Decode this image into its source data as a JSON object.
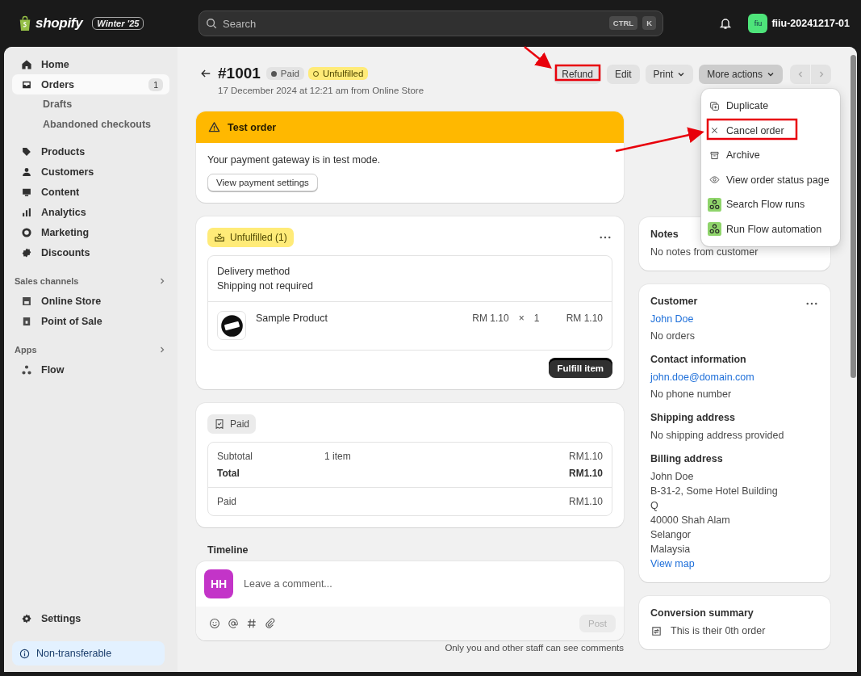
{
  "topbar": {
    "logo": "shopify",
    "edition_badge": "Winter '25",
    "search": {
      "placeholder": "Search",
      "shortcut": [
        "CTRL",
        "K"
      ]
    },
    "avatar": "fiu",
    "store_name": "fiiu-20241217-01"
  },
  "sidebar": {
    "items": [
      {
        "label": "Home",
        "selected": false
      },
      {
        "label": "Orders",
        "selected": true,
        "badge": "1",
        "children": [
          {
            "label": "Drafts",
            "selected": false
          },
          {
            "label": "Abandoned checkouts",
            "selected": false
          }
        ]
      },
      {
        "label": "Products",
        "selected": false
      },
      {
        "label": "Customers",
        "selected": false
      },
      {
        "label": "Content",
        "selected": false
      },
      {
        "label": "Analytics",
        "selected": false
      },
      {
        "label": "Marketing",
        "selected": false
      },
      {
        "label": "Discounts",
        "selected": false
      }
    ],
    "sections": [
      {
        "title": "Sales channels",
        "items": [
          {
            "label": "Online Store",
            "selected": false
          },
          {
            "label": "Point of Sale",
            "selected": false
          }
        ]
      },
      {
        "title": "Apps",
        "items": [
          {
            "label": "Flow",
            "selected": false
          }
        ]
      }
    ],
    "settings": "Settings",
    "plan_notice": "Non-transferable"
  },
  "header": {
    "title": "#1001",
    "badges": [
      {
        "label": "Paid",
        "kind": "paid"
      },
      {
        "label": "Unfulfilled",
        "kind": "unfulfilled"
      }
    ],
    "subtitle": "17 December 2024 at 12:21 am from Online Store",
    "actions": [
      {
        "label": "Refund",
        "kind": "plain",
        "expanded": false
      },
      {
        "label": "Edit",
        "kind": "plain",
        "expanded": false
      },
      {
        "label": "Print",
        "kind": "menu",
        "expanded": false
      },
      {
        "label": "More actions",
        "kind": "menu",
        "expanded": true
      }
    ]
  },
  "menu": [
    {
      "label": "Duplicate"
    },
    {
      "label": "Cancel order"
    },
    {
      "label": "Archive"
    },
    {
      "label": "View order status page"
    },
    {
      "label": "Search Flow runs"
    },
    {
      "label": "Run Flow automation"
    }
  ],
  "test_order": {
    "title": "Test order",
    "message": "Your payment gateway is in test mode.",
    "button": "View payment settings"
  },
  "fulfillment": {
    "status": "Unfulfilled (1)",
    "delivery_label": "Delivery method",
    "delivery_value": "Shipping not required",
    "line_items": [
      {
        "name": "Sample Product",
        "price": "RM 1.10",
        "times": "×",
        "quantity": "1",
        "total": "RM 1.10"
      }
    ],
    "button": "Fulfill item"
  },
  "payment": {
    "status": "Paid",
    "rows": [
      {
        "label": "Subtotal",
        "detail": "1 item",
        "amount": "RM1.10",
        "bold": false
      },
      {
        "label": "Total",
        "amount": "RM1.10",
        "bold": true
      }
    ],
    "paid_row": {
      "label": "Paid",
      "amount": "RM1.10"
    }
  },
  "timeline": {
    "title": "Timeline",
    "avatar": "HH",
    "comment_placeholder": "Leave a comment...",
    "post_button": "Post",
    "post_disabled": true,
    "note": "Only you and other staff can see comments"
  },
  "notes": {
    "title": "Notes",
    "text": "No notes from customer"
  },
  "customer": {
    "title": "Customer",
    "name": "John Doe",
    "orders": "No orders",
    "contact_title": "Contact information",
    "email": "john.doe@domain.com",
    "phone": "No phone number",
    "shipping_title": "Shipping address",
    "shipping": "No shipping address provided",
    "billing_title": "Billing address",
    "billing_lines": [
      "John Doe",
      "B-31-2, Some Hotel Building",
      "Q",
      "40000 Shah Alam",
      "Selangor",
      "Malaysia"
    ],
    "map_link": "View map"
  },
  "conversion": {
    "title": "Conversion summary",
    "text": "This is their 0th order"
  }
}
